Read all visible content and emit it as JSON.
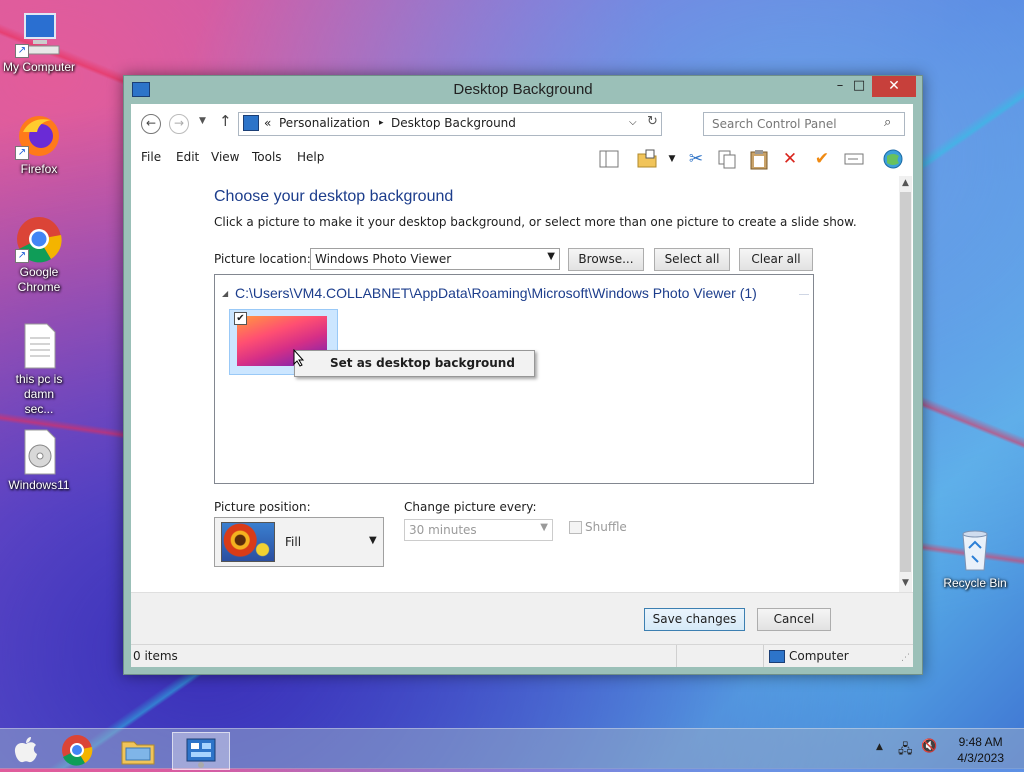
{
  "desktop": {
    "icons": [
      {
        "label": "My Computer"
      },
      {
        "label": "Firefox"
      },
      {
        "label": "Google Chrome"
      },
      {
        "label": "this pc is damn sec..."
      },
      {
        "label": "Windows11"
      },
      {
        "label": "Recycle Bin"
      }
    ]
  },
  "window": {
    "title": "Desktop Background",
    "minimize": "–",
    "maximize": "□",
    "close": "✕"
  },
  "address": {
    "back_glyph": "←",
    "forward_glyph": "→",
    "up_glyph": "↑",
    "prefix": "«",
    "crumb1": "Personalization",
    "sep": "▸",
    "crumb2": "Desktop Background",
    "search_placeholder": "Search Control Panel"
  },
  "menu": {
    "file": "File",
    "edit": "Edit",
    "view": "View",
    "tools": "Tools",
    "help": "Help"
  },
  "page": {
    "heading": "Choose your desktop background",
    "subtext": "Click a picture to make it your desktop background, or select more than one picture to create a slide show.",
    "picture_location_label": "Picture location:",
    "picture_location_value": "Windows Photo Viewer",
    "browse": "Browse...",
    "select_all": "Select all",
    "clear_all": "Clear all",
    "group_title": "C:\\Users\\VM4.COLLABNET\\AppData\\Roaming\\Microsoft\\Windows Photo Viewer (1)",
    "thumbnail_checked": true,
    "context_menu_item": "Set as desktop background",
    "picture_position_label": "Picture position:",
    "picture_position_value": "Fill",
    "change_every_label": "Change picture every:",
    "change_every_value": "30 minutes",
    "shuffle_label": "Shuffle",
    "save": "Save changes",
    "cancel": "Cancel"
  },
  "status": {
    "items": "0 items",
    "zone": "Computer"
  },
  "taskbar": {
    "time": "9:48 AM",
    "date": "4/3/2023"
  },
  "colors": {
    "accent_heading": "#1c3d8c",
    "close_button": "#c7403b",
    "window_frame": "#9bc0b8"
  }
}
